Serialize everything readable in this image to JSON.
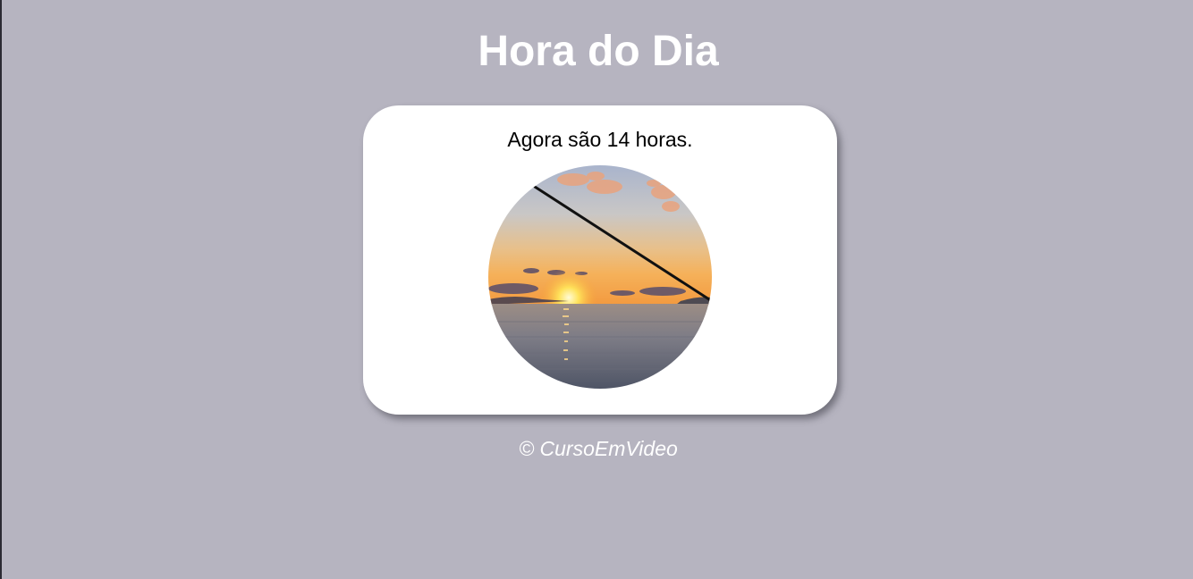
{
  "page": {
    "title": "Hora do Dia",
    "message": "Agora são 14 horas.",
    "footer": "© CursoEmVideo"
  },
  "image": {
    "subject": "sunset-over-sea-with-fishing-rod",
    "shape": "circle"
  },
  "colors": {
    "background": "#b6b4c0",
    "card": "#ffffff",
    "title_text": "#ffffff",
    "message_text": "#000000",
    "footer_text": "#ffffff"
  }
}
